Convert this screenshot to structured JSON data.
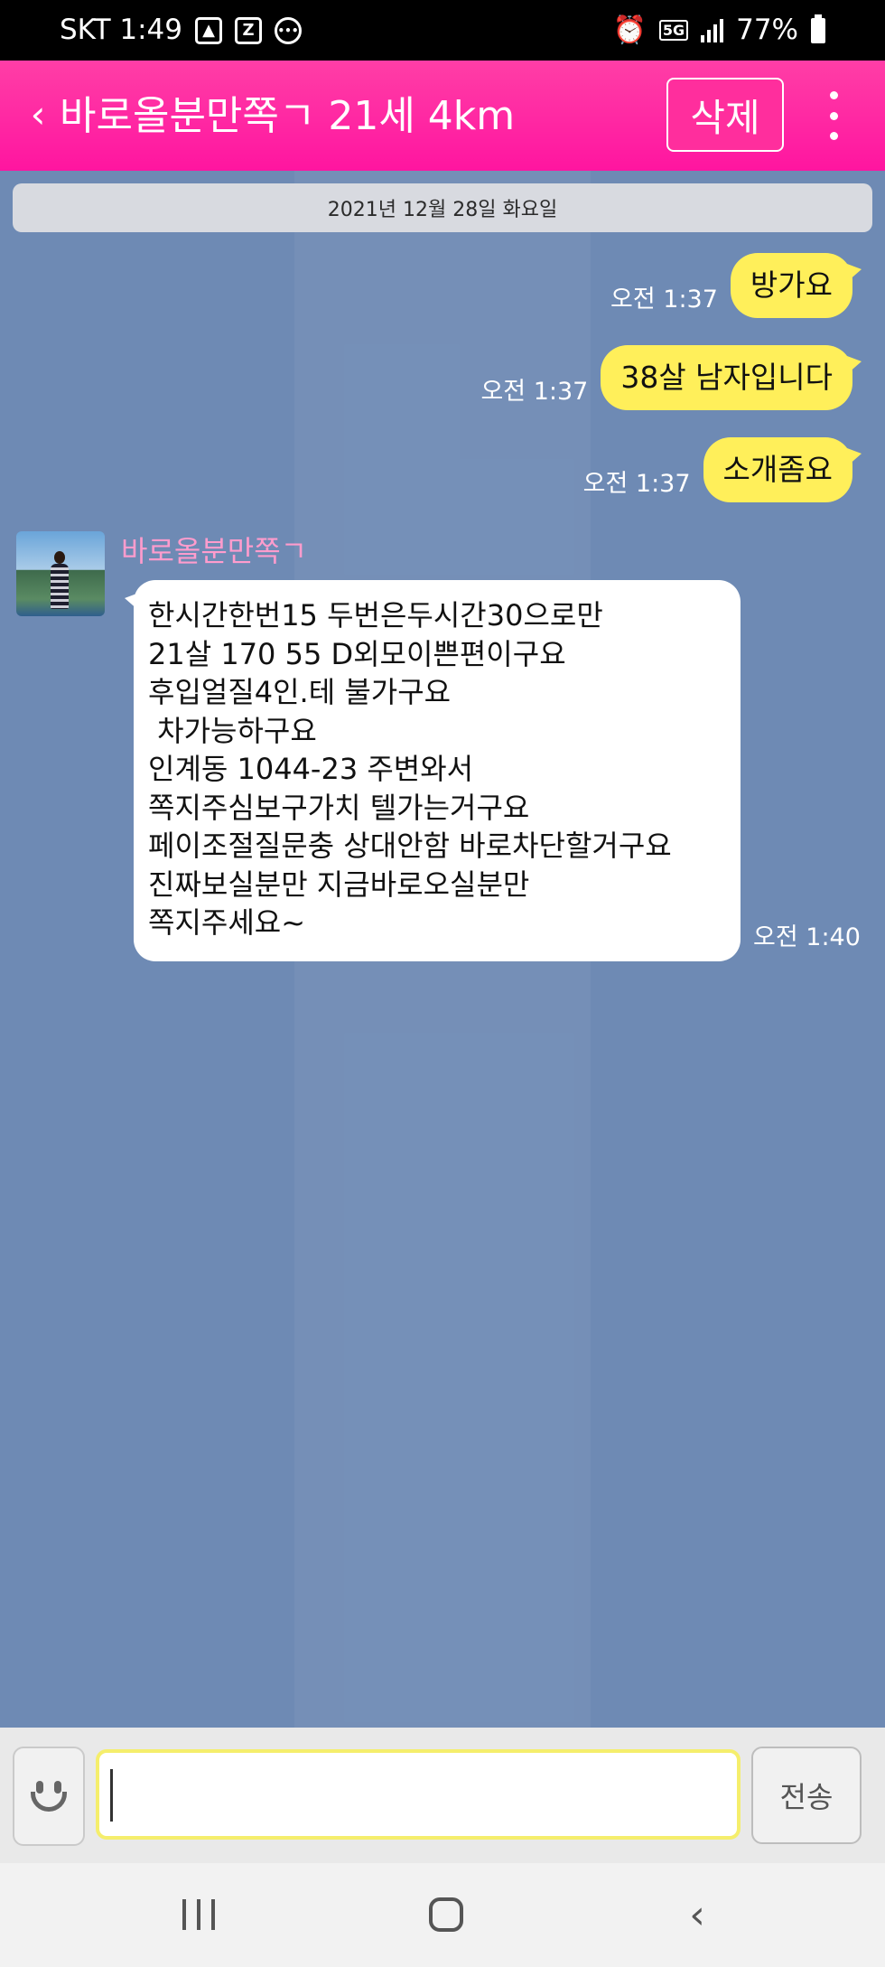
{
  "status_bar": {
    "carrier_time": "SKT 1:49",
    "icons": [
      "gallery-icon",
      "z-app-icon",
      "message-badge-icon",
      "alarm-icon",
      "5g-icon",
      "signal-icon",
      "battery-icon"
    ],
    "network": "5G",
    "battery": "77%"
  },
  "header": {
    "title": "바로올분만쪽ㄱ 21세 4km",
    "delete_label": "삭제",
    "accent_color": "#ff1fa2"
  },
  "chat": {
    "date": "2021년 12월 28일 화요일",
    "outgoing": [
      {
        "text": "방가요",
        "time": "오전 1:37"
      },
      {
        "text": "38살 남자입니다",
        "time": "오전 1:37"
      },
      {
        "text": "소개좀요",
        "time": "오전 1:37"
      }
    ],
    "incoming": {
      "sender": "바로올분만쪽ㄱ",
      "time": "오전 1:40",
      "lines": [
        "한시간한번15 두번은두시간30으로만",
        "21살 170 55 D외모이쁜편이구요",
        "후입얼질4인.테 불가구요",
        " 차가능하구요",
        "인계동 1044-23 주변와서",
        "쪽지주심보구가치 텔가는거구요",
        "페이조절질문충 상대안함 바로차단할거구요",
        "진짜보실분만 지금바로오실분만",
        "쪽지주세요~"
      ]
    }
  },
  "input": {
    "value": "",
    "send_label": "전송"
  }
}
